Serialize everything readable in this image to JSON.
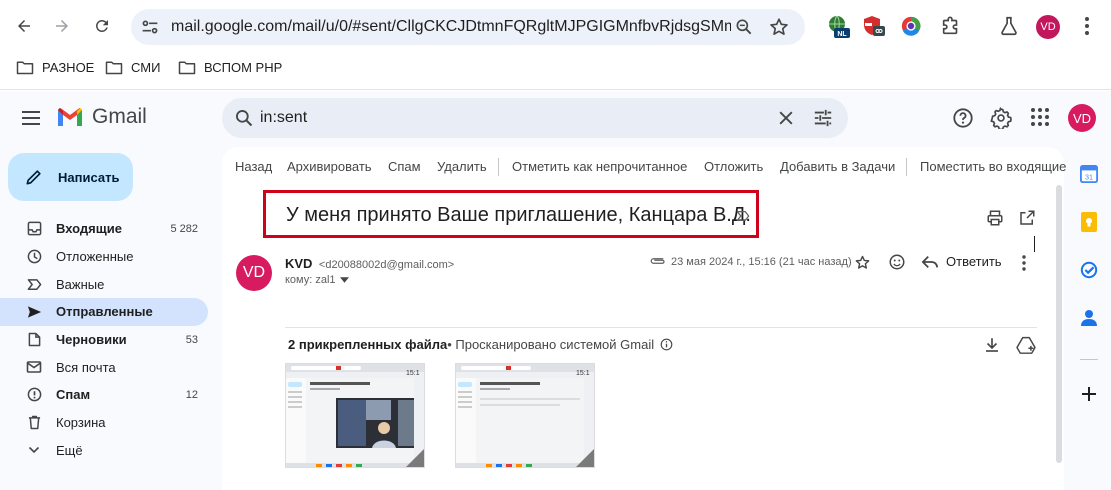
{
  "browser": {
    "url": "mail.google.com/mail/u/0/#sent/CllgCKCJDtmnFQRgltMJPGIGMnfbvRjdsgSMmP...",
    "bookmarks": [
      "РАЗНОЕ",
      "СМИ",
      "ВСПОМ PHP"
    ],
    "profile_initials": "VD",
    "ext_badge": "NL"
  },
  "gmail": {
    "logo_text": "Gmail",
    "search_query": "in:sent",
    "avatar_initials": "VD",
    "compose_label": "Написать",
    "nav": [
      {
        "label": "Входящие",
        "count": "5 282",
        "bold": true,
        "icon": "inbox-icon"
      },
      {
        "label": "Отложенные",
        "count": "",
        "bold": false,
        "icon": "clock-icon"
      },
      {
        "label": "Важные",
        "count": "",
        "bold": false,
        "icon": "important-icon"
      },
      {
        "label": "Отправленные",
        "count": "",
        "bold": true,
        "icon": "send-icon",
        "active": true
      },
      {
        "label": "Черновики",
        "count": "53",
        "bold": true,
        "icon": "draft-icon"
      },
      {
        "label": "Вся почта",
        "count": "",
        "bold": false,
        "icon": "all-mail-icon"
      },
      {
        "label": "Спам",
        "count": "12",
        "bold": true,
        "icon": "spam-icon"
      },
      {
        "label": "Корзина",
        "count": "",
        "bold": false,
        "icon": "trash-icon"
      },
      {
        "label": "Ещё",
        "count": "",
        "bold": false,
        "icon": "expand-icon"
      }
    ],
    "toolbar": {
      "back": "Назад",
      "archive": "Архивировать",
      "spam": "Спам",
      "delete": "Удалить",
      "mark_unread": "Отметить как непрочитанное",
      "snooze": "Отложить",
      "add_tasks": "Добавить в Задачи",
      "move_inbox": "Поместить во входящие"
    },
    "email": {
      "subject": "У меня принято Ваше приглашение, Канцара В.Д.",
      "sender_initials": "VD",
      "sender_name": "KVD",
      "sender_email": "<d20088002d@gmail.com>",
      "to": "кому: zal1",
      "date": "23 мая 2024 г., 15:16 (21 час назад)",
      "reply_label": "Ответить",
      "attachments_count_label": "2 прикрепленных файла",
      "attachments_scan_label": " • Просканировано системой Gmail",
      "thumb_time": "15:1"
    },
    "colors": {
      "highlight_box": "#d0021b",
      "compose_bg": "#c2e7ff",
      "active_nav": "#d3e3fd",
      "avatar": "#d81b60"
    }
  }
}
